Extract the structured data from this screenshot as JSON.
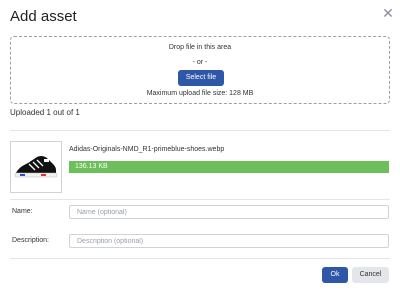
{
  "dialog": {
    "title": "Add asset"
  },
  "dropzone": {
    "drop_text": "Drop file in this area",
    "or_text": "- or -",
    "select_label": "Select file",
    "max_size_text": "Maximum upload file size: 128 MB"
  },
  "upload": {
    "status_text": "Uploaded 1 out of 1",
    "file_name": "Adidas-Originals-NMD_R1-primeblue-shoes.webp",
    "file_size": "136.13 KB",
    "progress_fraction": 1.0
  },
  "form": {
    "name_label": "Name:",
    "name_placeholder": "Name (optional)",
    "name_value": "",
    "description_label": "Description:",
    "description_placeholder": "Description (optional)",
    "description_value": ""
  },
  "actions": {
    "ok_label": "Ok",
    "cancel_label": "Cancel"
  },
  "colors": {
    "primary": "#2f57a8",
    "progress": "#6cbf5b"
  },
  "icons": {
    "close": "close-icon",
    "thumbnail": "shoe-thumbnail"
  }
}
